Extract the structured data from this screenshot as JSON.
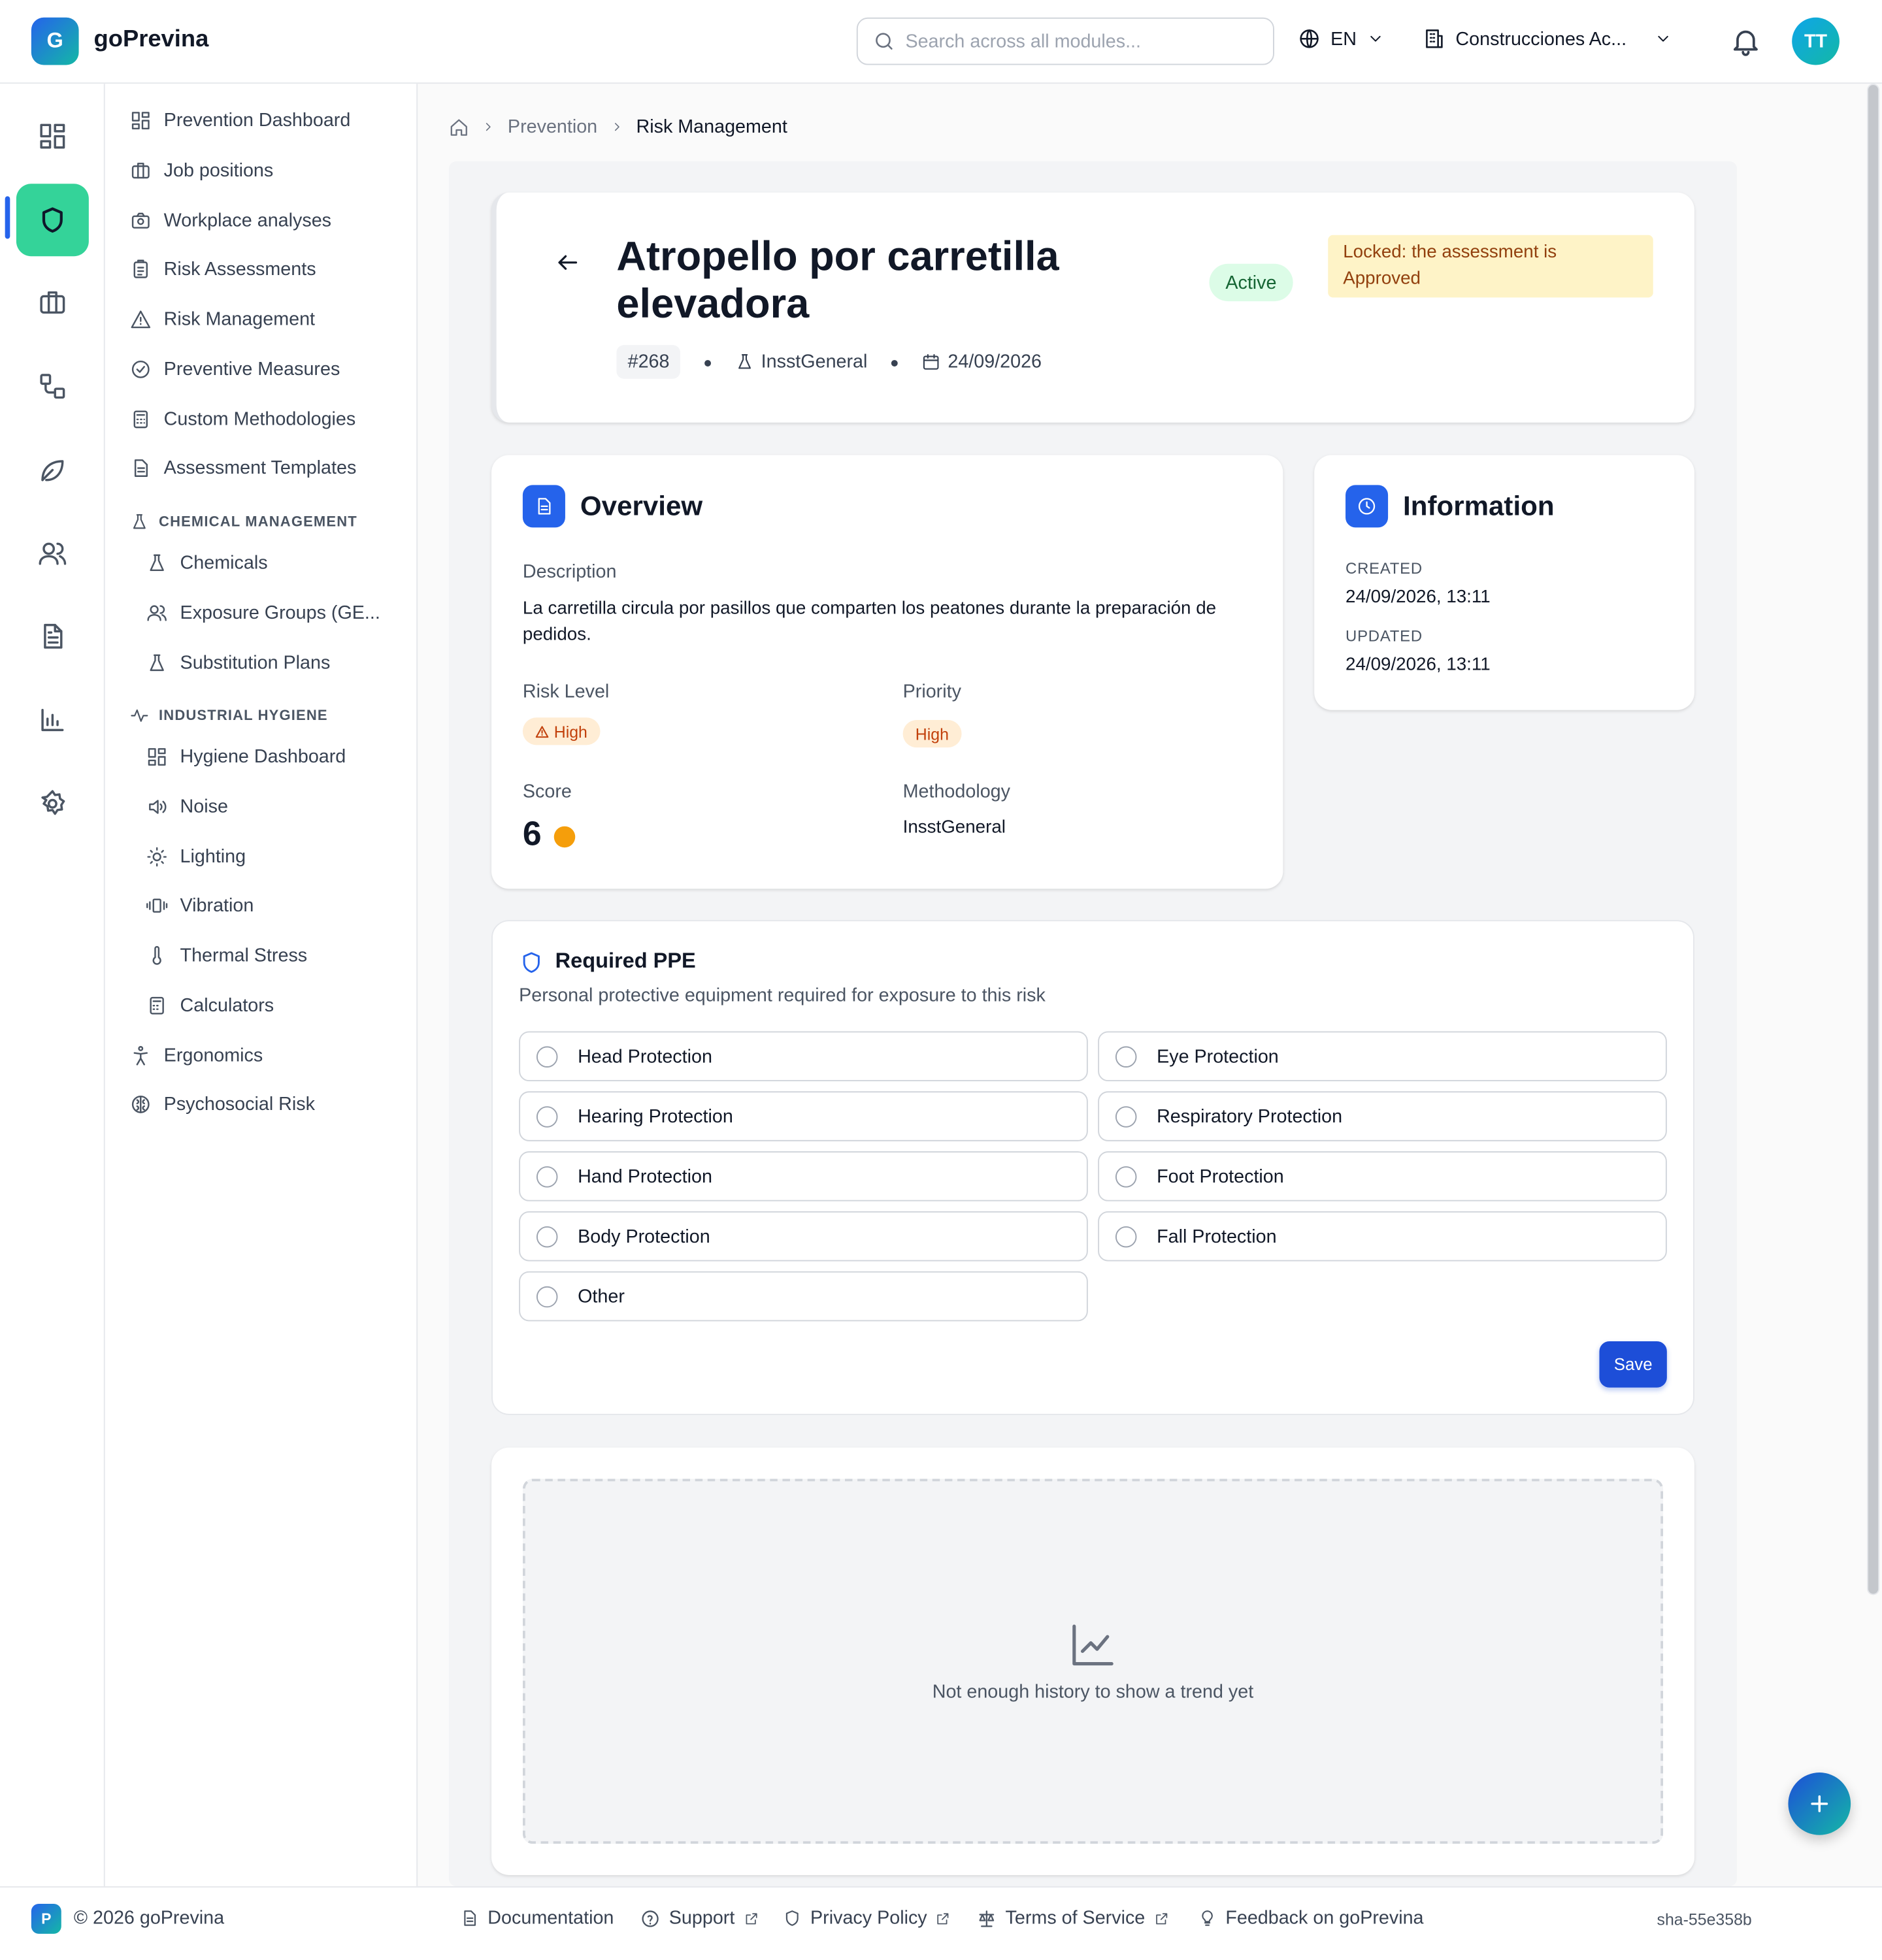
{
  "app": {
    "logo_letter": "G",
    "name": "goPrevina"
  },
  "topbar": {
    "search_placeholder": "Search across all modules...",
    "language": "EN",
    "company": "Construcciones Ac...",
    "avatar_initials": "TT"
  },
  "rail": {
    "items": [
      "dashboard-icon",
      "shield-icon",
      "briefcase-icon",
      "workflow-icon",
      "leaf-icon",
      "users-icon",
      "document-icon",
      "bar-chart-icon",
      "gear-icon"
    ],
    "active": "shield-icon",
    "accent": "#34d399"
  },
  "subnav": {
    "items": [
      {
        "label": "Prevention Dashboard",
        "icon": "grid-icon"
      },
      {
        "label": "Job positions",
        "icon": "briefcase-icon"
      },
      {
        "label": "Workplace analyses",
        "icon": "camera-icon"
      },
      {
        "label": "Risk Assessments",
        "icon": "clipboard-icon"
      },
      {
        "label": "Risk Management",
        "icon": "warning-icon"
      },
      {
        "label": "Preventive Measures",
        "icon": "check-circle-icon"
      },
      {
        "label": "Custom Methodologies",
        "icon": "calculator-icon"
      },
      {
        "label": "Assessment Templates",
        "icon": "file-icon"
      }
    ],
    "chemical_heading": "CHEMICAL MANAGEMENT",
    "chemical_items": [
      {
        "label": "Chemicals",
        "icon": "flask-icon"
      },
      {
        "label": "Exposure Groups (GE...",
        "icon": "users-icon"
      },
      {
        "label": "Substitution Plans",
        "icon": "flask-icon"
      }
    ],
    "hygiene_heading": "INDUSTRIAL HYGIENE",
    "hygiene_items": [
      {
        "label": "Hygiene Dashboard",
        "icon": "grid-icon"
      },
      {
        "label": "Noise",
        "icon": "speaker-icon"
      },
      {
        "label": "Lighting",
        "icon": "sun-icon"
      },
      {
        "label": "Vibration",
        "icon": "vibration-icon"
      },
      {
        "label": "Thermal Stress",
        "icon": "thermometer-icon"
      },
      {
        "label": "Calculators",
        "icon": "calculator-icon"
      }
    ],
    "bottom_items": [
      {
        "label": "Ergonomics",
        "icon": "person-icon"
      },
      {
        "label": "Psychosocial Risk",
        "icon": "brain-icon"
      }
    ]
  },
  "breadcrumb": {
    "home": "home-icon",
    "section": "Prevention",
    "current": "Risk Management"
  },
  "risk": {
    "title": "Atropello por carretilla elevadora",
    "status": "Active",
    "locked_message": "Locked: the assessment is Approved",
    "id": "#268",
    "methodology": "InsstGeneral",
    "date": "24/09/2026"
  },
  "overview": {
    "title": "Overview",
    "description_label": "Description",
    "description": "La carretilla circula por pasillos que comparten los peatones durante la preparación de pedidos.",
    "risk_level_label": "Risk Level",
    "risk_level": "High",
    "priority_label": "Priority",
    "priority": "High",
    "score_label": "Score",
    "score": "6",
    "score_color": "#f59e0b",
    "methodology_label": "Methodology",
    "methodology": "InsstGeneral"
  },
  "information": {
    "title": "Information",
    "created_label": "CREATED",
    "created": "24/09/2026, 13:11",
    "updated_label": "UPDATED",
    "updated": "24/09/2026, 13:11"
  },
  "ppe": {
    "title": "Required PPE",
    "subtitle": "Personal protective equipment required for exposure to this risk",
    "options": [
      "Head Protection",
      "Eye Protection",
      "Hearing Protection",
      "Respiratory Protection",
      "Hand Protection",
      "Foot Protection",
      "Body Protection",
      "Fall Protection",
      "Other"
    ],
    "save_label": "Save"
  },
  "trend": {
    "message": "Not enough history to show a trend yet"
  },
  "footer": {
    "logo_letter": "P",
    "copyright": "© 2026 goPrevina",
    "links": [
      "Documentation",
      "Support",
      "Privacy Policy",
      "Terms of Service",
      "Feedback on goPrevina"
    ],
    "build": "sha-55e358b"
  },
  "colors": {
    "primary": "#2563eb",
    "accent": "#34d399",
    "warning_bg": "#fef3c7",
    "high_bg": "#ffedd5",
    "active_bg": "#dcfce7"
  }
}
